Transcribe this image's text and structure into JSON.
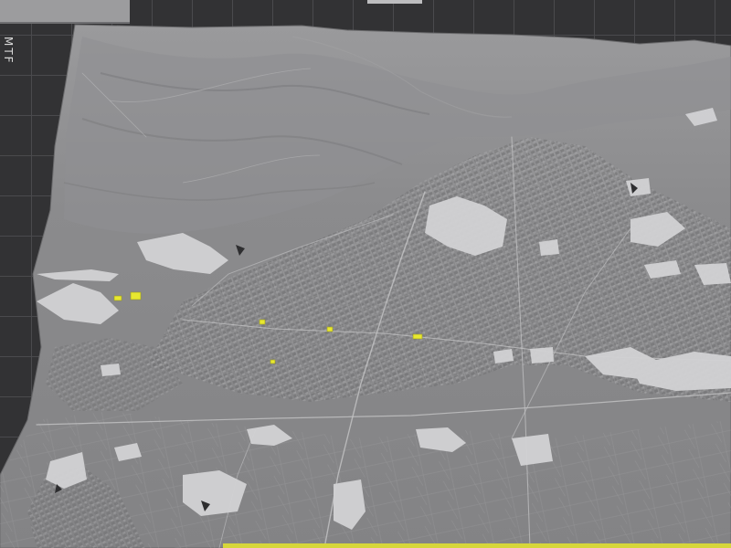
{
  "viewport": {
    "ruler_text": "MTF",
    "accent_color": "#d6d63a",
    "marker_color": "#e8e830",
    "terrain_color": "#8c8c8e",
    "grid_color": "#4a4a4d"
  }
}
